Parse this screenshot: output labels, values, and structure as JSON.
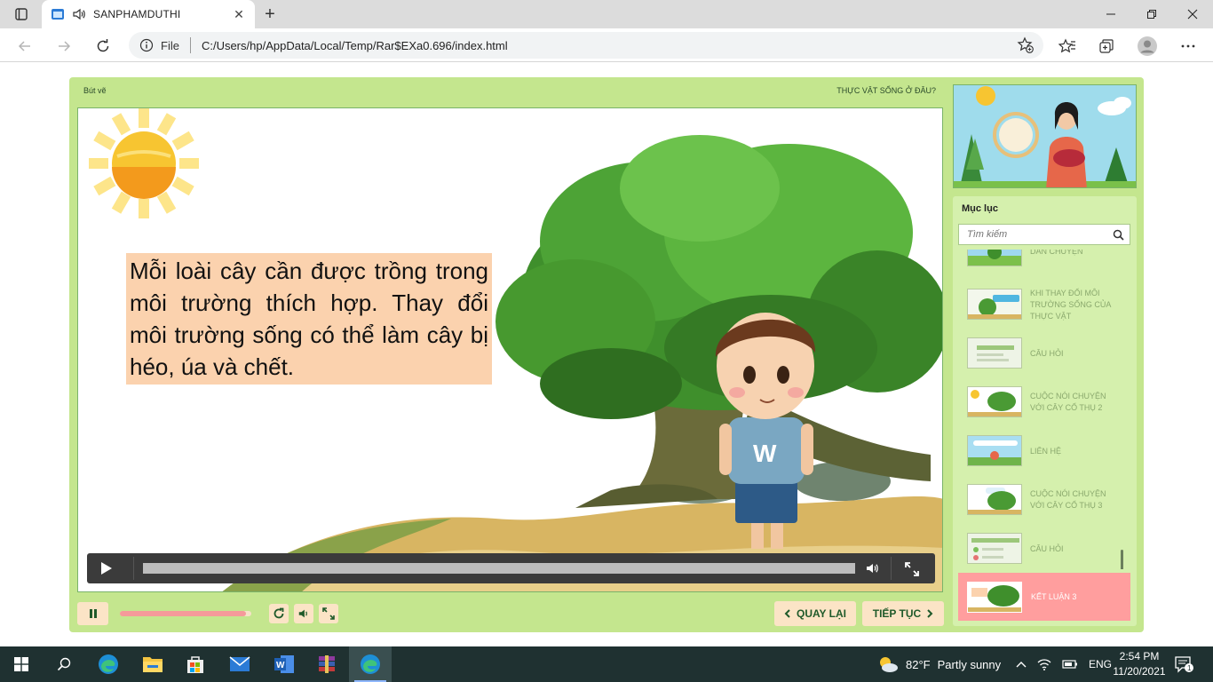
{
  "browser": {
    "tab_title": "SANPHAMDUTHI",
    "file_label": "File",
    "url": "C:/Users/hp/AppData/Local/Temp/Rar$EXa0.696/index.html"
  },
  "player": {
    "tool_label": "Bút vẽ",
    "slide_title": "THỰC VẬT SỐNG Ở ĐÂU?",
    "caption": "Mỗi loài cây cần được trồng trong môi trường thích hợp. Thay đổi môi trường sống có thể làm cây bị héo, úa và chết.",
    "slide_progress": 0.96,
    "video_progress": 0.0,
    "prev_label": "QUAY LẠI",
    "next_label": "TIẾP TỤC"
  },
  "toc": {
    "title": "Mục lục",
    "search_placeholder": "Tìm kiếm",
    "items": [
      {
        "label": "DẪN CHUYỆN"
      },
      {
        "label": "KHI THAY ĐỔI MÔI TRƯỜNG SỐNG CỦA THỰC VẬT"
      },
      {
        "label": "CÂU HỎI"
      },
      {
        "label": "CUỘC NÓI CHUYỆN VỚI CÂY CỔ THỤ 2"
      },
      {
        "label": "LIÊN HỆ"
      },
      {
        "label": "CUỘC NÓI CHUYỆN VỚI CÂY CỔ THỤ 3"
      },
      {
        "label": "CÂU HỎI"
      }
    ],
    "active_item": {
      "label": "KẾT LUẬN 3"
    }
  },
  "taskbar": {
    "temperature": "82°F",
    "weather": "Partly sunny",
    "language": "ENG",
    "time": "2:54 PM",
    "date": "11/20/2021",
    "notification_count": "1"
  },
  "colors": {
    "player_bg": "#c4e68e",
    "caption_bg": "#fbd2ae",
    "active_toc": "#ff9e9e",
    "button_bg": "#fbe4c6",
    "progress_fill": "#f59a9a"
  }
}
